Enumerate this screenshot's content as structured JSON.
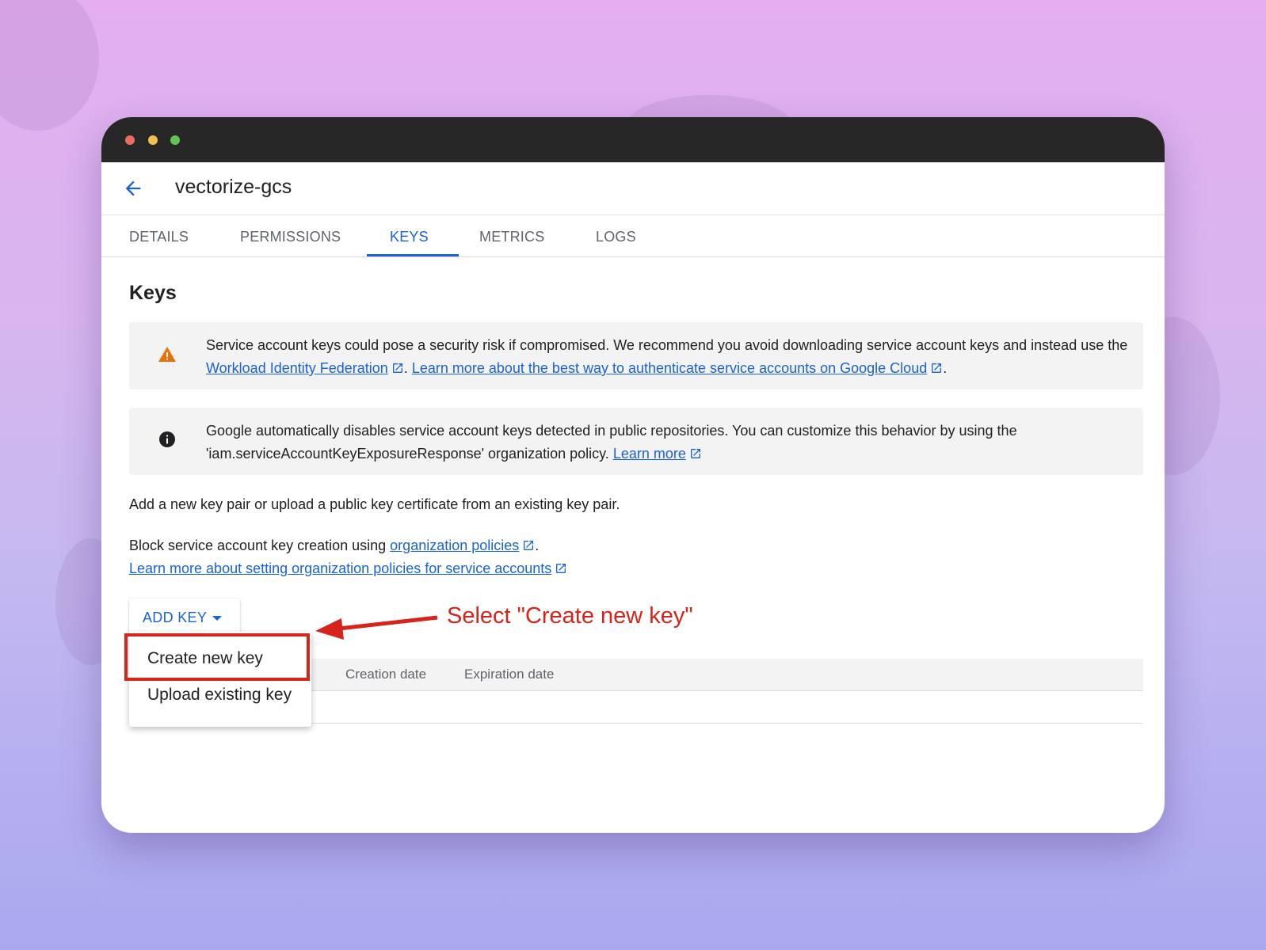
{
  "window": {
    "title": "vectorize-gcs"
  },
  "tabs": [
    {
      "label": "DETAILS"
    },
    {
      "label": "PERMISSIONS"
    },
    {
      "label": "KEYS"
    },
    {
      "label": "METRICS"
    },
    {
      "label": "LOGS"
    }
  ],
  "active_tab": "KEYS",
  "section": {
    "heading": "Keys"
  },
  "warning_banner": {
    "text_1": "Service account keys could pose a security risk if compromised. We recommend you avoid downloading service account keys and instead use the ",
    "link_1": "Workload Identity Federation",
    "sep": ". ",
    "link_2": "Learn more about the best way to authenticate service accounts on Google Cloud",
    "end": "."
  },
  "info_banner": {
    "text": "Google automatically disables service account keys detected in public repositories. You can customize this behavior by using the 'iam.serviceAccountKeyExposureResponse' organization policy. ",
    "link": "Learn more"
  },
  "add_key_paragraph": "Add a new key pair or upload a public key certificate from an existing key pair.",
  "block_paragraph": {
    "text": "Block service account key creation using ",
    "link": "organization policies",
    "end": ".",
    "link_2": "Learn more about setting organization policies for service accounts"
  },
  "add_key_button": {
    "label": "ADD KEY"
  },
  "dropdown": {
    "items": [
      {
        "label": "Create new key"
      },
      {
        "label": "Upload existing key"
      }
    ]
  },
  "table": {
    "columns": [
      "Creation date",
      "Expiration date"
    ]
  },
  "annotation": {
    "text": "Select \"Create new key\""
  },
  "colors": {
    "accent": "#1a62d6",
    "annotation": "#d6231b",
    "warning": "#e8710a",
    "titlebar": "#272727"
  }
}
